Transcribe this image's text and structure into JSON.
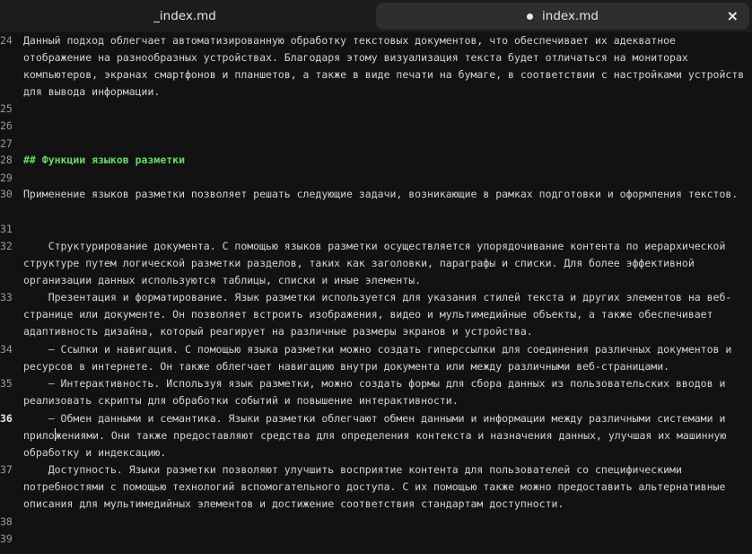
{
  "tabs": [
    {
      "label": "_index.md",
      "modified": false,
      "active": false
    },
    {
      "label": "index.md",
      "modified": true,
      "active": true
    }
  ],
  "editor": {
    "lines": [
      {
        "number": "24",
        "text": "Данный подход облегчает автоматизированную обработку текстовых документов, что обеспечивает их адекватное отображение на разнообразных устройствах. Благодаря этому визуализация текста будет отличаться на мониторах компьютеров, экранах смартфонов и планшетов, а также в виде печати на бумаге, в соответствии с настройками устройств для вывода информации."
      },
      {
        "number": "25",
        "text": ""
      },
      {
        "number": "26",
        "text": ""
      },
      {
        "number": "27",
        "text": ""
      },
      {
        "number": "28",
        "text": "## Функции языков разметки"
      },
      {
        "number": "29",
        "text": ""
      },
      {
        "number": "30",
        "text": "Применение языков разметки позволяет решать следующие задачи, возникающие в рамках подготовки и оформления текстов."
      },
      {
        "number": "31",
        "text": ""
      },
      {
        "number": "32",
        "text": "    Структурирование документа. С помощью языков разметки осуществляется упорядочивание контента по иерархической структуре путем логической разметки разделов, таких как заголовки, параграфы и списки. Для более эффективной организации данных используются таблицы, списки и иные элементы."
      },
      {
        "number": "33",
        "text": "    Презентация и форматирование. Язык разметки используется для указания стилей текста и других элементов на веб-странице или документе. Он позволяет встроить изображения, видео и мультимедийные объекты, а также обеспечивает адаптивность дизайна, который реагирует на различные размеры экранов и устройства."
      },
      {
        "number": "34",
        "text": "    – Ссылки и навигация. С помощью языка разметки можно создать гиперссылки для соединения различных документов и ресурсов в интернете. Он также облегчает навигацию внутри документа или между различными веб-страницами."
      },
      {
        "number": "35",
        "text": "    – Интерактивность. Используя язык разметки, можно создать формы для сбора данных из пользовательских вводов и реализовать скрипты для обработки событий и повышение интерактивности."
      },
      {
        "number": "36",
        "text_before_cursor": "    – Обмен данными и семантика. Языки разметки облегчают обмен данными и информации между различными системами и прило",
        "text_after_cursor": "жениями. Они также предоставляют средства для определения контекста и назначения данных, улучшая их машинную обработку и индексацию."
      },
      {
        "number": "37",
        "text": "    Доступность. Языки разметки позволяют улучшить восприятие контента для пользователей со специфическими потребностями с помощью технологий вспомогательного доступа. С их помощью также можно предоставить альтернативные описания для мультимедийных элементов и достижение соответствия стандартам доступности."
      },
      {
        "number": "38",
        "text": ""
      },
      {
        "number": "39",
        "text": ""
      }
    ]
  },
  "colors": {
    "background": "#121212",
    "heading": "#6bd968",
    "text": "#d4d4d4",
    "line_number": "#9a9a9a"
  }
}
